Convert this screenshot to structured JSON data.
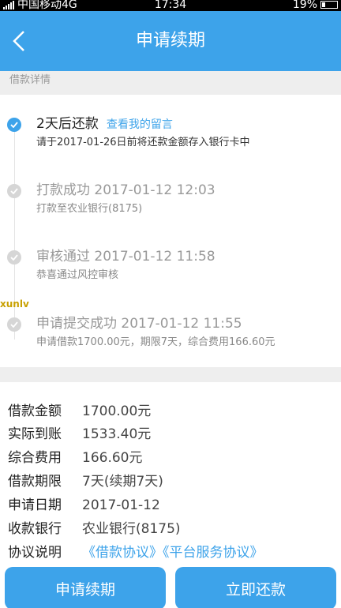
{
  "status_bar": {
    "carrier": "中国移动4G",
    "time": "17:34",
    "battery": "19%"
  },
  "header": {
    "title": "申请续期"
  },
  "section": {
    "label": "借款详情"
  },
  "timeline": [
    {
      "title": "2天后还款",
      "link": "查看我的留言",
      "desc": "请于2017-01-26日前将还款金额存入银行卡中",
      "active": true
    },
    {
      "title": "打款成功 2017-01-12 12:03",
      "desc": "打款至农业银行(8175)",
      "active": false
    },
    {
      "title": "审核通过 2017-01-12 11:58",
      "desc": "恭喜通过风控审核",
      "active": false
    },
    {
      "title": "申请提交成功 2017-01-12 11:55",
      "desc": "申请借款1700.00元，期限7天，综合费用166.60元",
      "active": false
    }
  ],
  "details": [
    {
      "label": "借款金额",
      "value": "1700.00元"
    },
    {
      "label": "实际到账",
      "value": "1533.40元"
    },
    {
      "label": "综合费用",
      "value": "166.60元"
    },
    {
      "label": "借款期限",
      "value": "7天(续期7天)"
    },
    {
      "label": "申请日期",
      "value": "2017-01-12"
    },
    {
      "label": "收款银行",
      "value": "农业银行(8175)"
    },
    {
      "label": "协议说明",
      "link1": "《借款协议》",
      "link2": "《平台服务协议》"
    }
  ],
  "buttons": {
    "renew": "申请续期",
    "repay": "立即还款"
  },
  "watermark": "xunlv",
  "colors": {
    "accent": "#3da3ea",
    "status_bar": "#000000",
    "background": "#eeeeee"
  }
}
